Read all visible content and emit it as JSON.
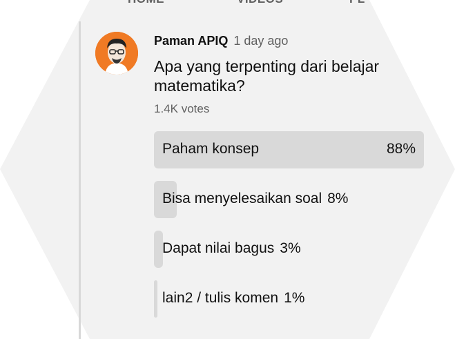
{
  "tabs": [
    "HOME",
    "VIDEOS",
    "PL"
  ],
  "post": {
    "author": "Paman APIQ",
    "time": "1 day ago",
    "question": "Apa yang terpenting dari belajar matematika?",
    "votes": "1.4K votes"
  },
  "poll": {
    "options": [
      {
        "label": "Paham konsep",
        "percent": "88%",
        "fraction": 0.88
      },
      {
        "label": "Bisa menyelesaikan soal",
        "percent": "8%",
        "fraction": 0.08
      },
      {
        "label": "Dapat nilai bagus",
        "percent": "3%",
        "fraction": 0.03
      },
      {
        "label": "lain2 / tulis komen",
        "percent": "1%",
        "fraction": 0.01
      }
    ]
  },
  "colors": {
    "accent_avatar": "#f07a24",
    "bar_fill": "#d9d9d9",
    "background": "#f2f2f2"
  }
}
